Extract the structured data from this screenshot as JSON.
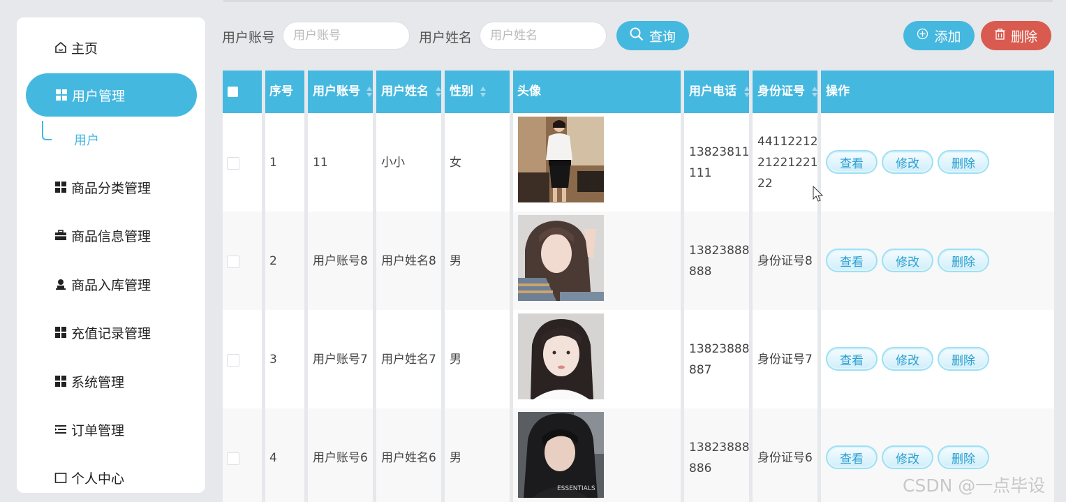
{
  "sidebar": {
    "items": [
      {
        "label": "主页",
        "icon": "home-icon"
      },
      {
        "label": "用户管理",
        "icon": "grid-icon",
        "active": true
      },
      {
        "label": "商品分类管理",
        "icon": "grid-icon"
      },
      {
        "label": "商品信息管理",
        "icon": "briefcase-icon"
      },
      {
        "label": "商品入库管理",
        "icon": "user-icon"
      },
      {
        "label": "充值记录管理",
        "icon": "grid-icon"
      },
      {
        "label": "系统管理",
        "icon": "grid-icon"
      },
      {
        "label": "订单管理",
        "icon": "list-icon"
      },
      {
        "label": "个人中心",
        "icon": "square-icon"
      }
    ],
    "sub_item": "用户"
  },
  "search": {
    "account_label": "用户账号",
    "account_placeholder": "用户账号",
    "account_value": "",
    "name_label": "用户姓名",
    "name_placeholder": "用户姓名",
    "name_value": "",
    "query_label": "查询"
  },
  "actions": {
    "add_label": "添加",
    "delete_label": "删除"
  },
  "table": {
    "headers": [
      "序号",
      "用户账号",
      "用户姓名",
      "性别",
      "头像",
      "用户电话",
      "身份证号",
      "操作"
    ],
    "rows": [
      {
        "index": "1",
        "account": "11",
        "name": "小小",
        "gender": "女",
        "phone_1": "13823811",
        "phone_2": "111",
        "id_1": "44112212",
        "id_2": "21221221",
        "id_3": "22"
      },
      {
        "index": "2",
        "account": "用户账号8",
        "name": "用户姓名8",
        "gender": "男",
        "phone_1": "13823888",
        "phone_2": "888",
        "id_1": "身份证号8",
        "id_2": "",
        "id_3": ""
      },
      {
        "index": "3",
        "account": "用户账号7",
        "name": "用户姓名7",
        "gender": "男",
        "phone_1": "13823888",
        "phone_2": "887",
        "id_1": "身份证号7",
        "id_2": "",
        "id_3": ""
      },
      {
        "index": "4",
        "account": "用户账号6",
        "name": "用户姓名6",
        "gender": "男",
        "phone_1": "13823888",
        "phone_2": "886",
        "id_1": "身份证号6",
        "id_2": "",
        "id_3": ""
      }
    ],
    "op_view": "查看",
    "op_edit": "修改",
    "op_delete": "删除"
  },
  "watermark": "CSDN @一点毕设",
  "colors": {
    "accent": "#45b8e0",
    "danger": "#d95b4f"
  }
}
